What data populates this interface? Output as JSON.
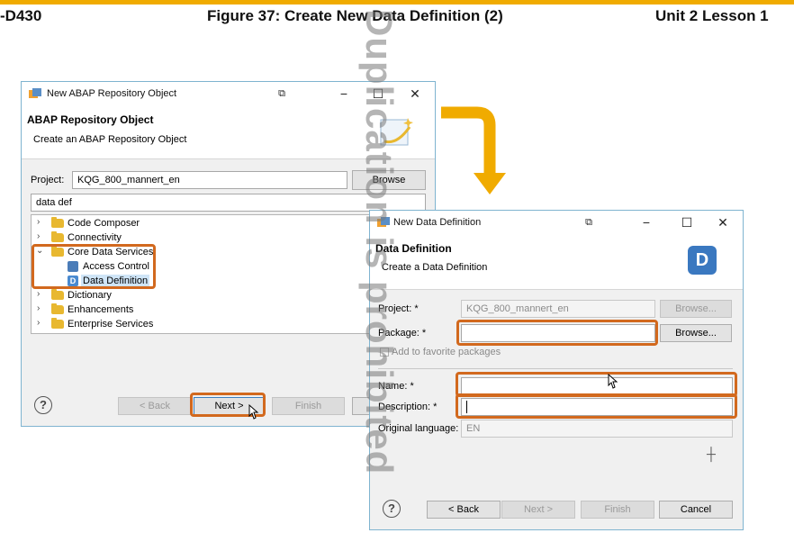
{
  "header": {
    "left": "-D430",
    "center": "Figure 37: Create New Data Definition (2)",
    "right": "Unit 2 Lesson 1",
    "watermark": "Duplication is prohibited"
  },
  "dialog1": {
    "title": "New ABAP Repository Object",
    "banner_title": "ABAP Repository Object",
    "banner_subtitle": "Create an ABAP Repository Object",
    "project_label": "Project:",
    "project_value": "KQG_800_mannert_en",
    "browse": "Browse",
    "filter_value": "data def",
    "tree": [
      {
        "label": "Code Composer",
        "level": 0,
        "expanded": false
      },
      {
        "label": "Connectivity",
        "level": 0,
        "expanded": false
      },
      {
        "label": "Core Data Services",
        "level": 0,
        "expanded": true
      },
      {
        "label": "Access Control",
        "level": 1
      },
      {
        "label": "Data Definition",
        "level": 1,
        "selected": true
      },
      {
        "label": "Dictionary",
        "level": 0,
        "expanded": false
      },
      {
        "label": "Enhancements",
        "level": 0,
        "expanded": false
      },
      {
        "label": "Enterprise Services",
        "level": 0,
        "expanded": false
      }
    ],
    "buttons": {
      "back": "< Back",
      "next": "Next >",
      "finish": "Finish"
    }
  },
  "dialog2": {
    "title": "New Data Definition",
    "banner_title": "Data Definition",
    "banner_subtitle": "Create a Data Definition",
    "banner_logo": "D",
    "project_label": "Project: *",
    "project_value": "KQG_800_mannert_en",
    "browse": "Browse...",
    "package_label": "Package: *",
    "package_value": "",
    "add_favorite": "Add to favorite packages",
    "name_label": "Name: *",
    "name_value": "",
    "description_label": "Description: *",
    "description_value": "",
    "original_language_label": "Original language:",
    "original_language_value": "EN",
    "buttons": {
      "back": "< Back",
      "next": "Next >",
      "finish": "Finish",
      "cancel": "Cancel"
    }
  },
  "colors": {
    "accent_bar": "#f0ab00",
    "arrow": "#f0ab00",
    "highlight": "#d2691e"
  }
}
